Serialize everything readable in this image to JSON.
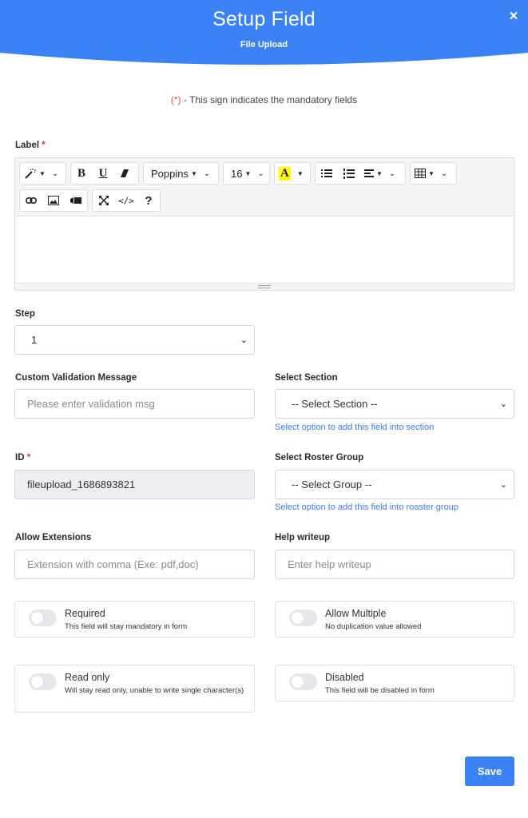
{
  "header": {
    "title": "Setup Field",
    "subtitle": "File Upload",
    "close_icon": "×",
    "color": "#3b82f6"
  },
  "mandatory_note": {
    "sign": "(*)",
    "text": " - This sign indicates the mandatory fields"
  },
  "label_field": {
    "label": "Label",
    "required_mark": "*",
    "toolbar": {
      "magic_icon": "🪄",
      "bold": "B",
      "underline": "U",
      "eraser_icon": "eraser",
      "font_family": "Poppins",
      "font_size": "16",
      "font_color": "A",
      "unordered_list": "unordered-list",
      "ordered_list": "ordered-list",
      "align": "align",
      "table": "table",
      "link": "link",
      "picture": "picture",
      "video": "video",
      "fullscreen": "fullscreen",
      "code_view": "</>",
      "help": "?"
    },
    "content": ""
  },
  "step": {
    "label": "Step",
    "value": "1"
  },
  "custom_validation": {
    "label": "Custom Validation Message",
    "placeholder": "Please enter validation msg",
    "value": ""
  },
  "select_section": {
    "label": "Select Section",
    "value": "-- Select Section --",
    "helper": "Select option to add this field into section"
  },
  "id_field": {
    "label": "ID",
    "required_mark": "*",
    "value": "fileupload_1686893821"
  },
  "roster_group": {
    "label": "Select Roster Group",
    "value": "-- Select Group --",
    "helper": "Select option to add this field into roaster group"
  },
  "allow_extensions": {
    "label": "Allow Extensions",
    "placeholder": "Extension with comma (Exe: pdf,doc)",
    "value": ""
  },
  "help_writeup": {
    "label": "Help writeup",
    "placeholder": "Enter help writeup",
    "value": ""
  },
  "toggles": [
    {
      "title": "Required",
      "desc": "This field will stay mandatory in form",
      "on": false
    },
    {
      "title": "Allow Multiple",
      "desc": "No duplication value allowed",
      "on": false
    },
    {
      "title": "Read only",
      "desc": "Will stay read only, unable to write single character(s)",
      "on": false
    },
    {
      "title": "Disabled",
      "desc": "This field will be disabled in form",
      "on": false
    }
  ],
  "save_label": "Save"
}
